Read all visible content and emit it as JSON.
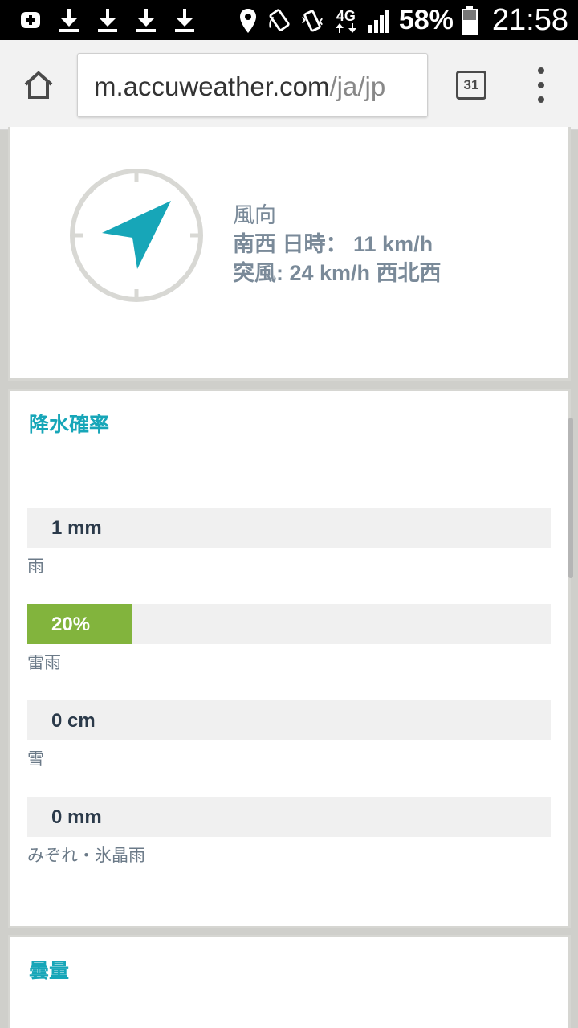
{
  "status_bar": {
    "icons": [
      "add-notification-icon",
      "download-icon",
      "download-icon",
      "download-icon",
      "download-icon",
      "location-icon",
      "rotate-icon",
      "vibrate-icon",
      "4g-icon",
      "signal-icon",
      "battery-icon"
    ],
    "network": "4G",
    "battery": "58%",
    "time": "21:58"
  },
  "browser": {
    "url_host": "m.accuweather.com",
    "url_path": "/ja/jp",
    "tab_count": "31"
  },
  "wind": {
    "heading": "風向",
    "line1": "南西 日時： 11 km/h",
    "line2": "突風: 24 km/h 西北西"
  },
  "precip": {
    "title": "降水確率",
    "rows": [
      {
        "value": "1 mm",
        "label": "雨",
        "fill_fraction": 0
      },
      {
        "value": "20%",
        "label": "雷雨",
        "fill_fraction": 0.2
      },
      {
        "value": "0 cm",
        "label": "雪",
        "fill_fraction": 0
      },
      {
        "value": "0 mm",
        "label": "みぞれ・氷晶雨",
        "fill_fraction": 0
      }
    ]
  },
  "cloud": {
    "title": "曇量"
  },
  "colors": {
    "accent": "#17a6b8",
    "fill": "#82b43d",
    "text_muted": "#7a8a99"
  }
}
